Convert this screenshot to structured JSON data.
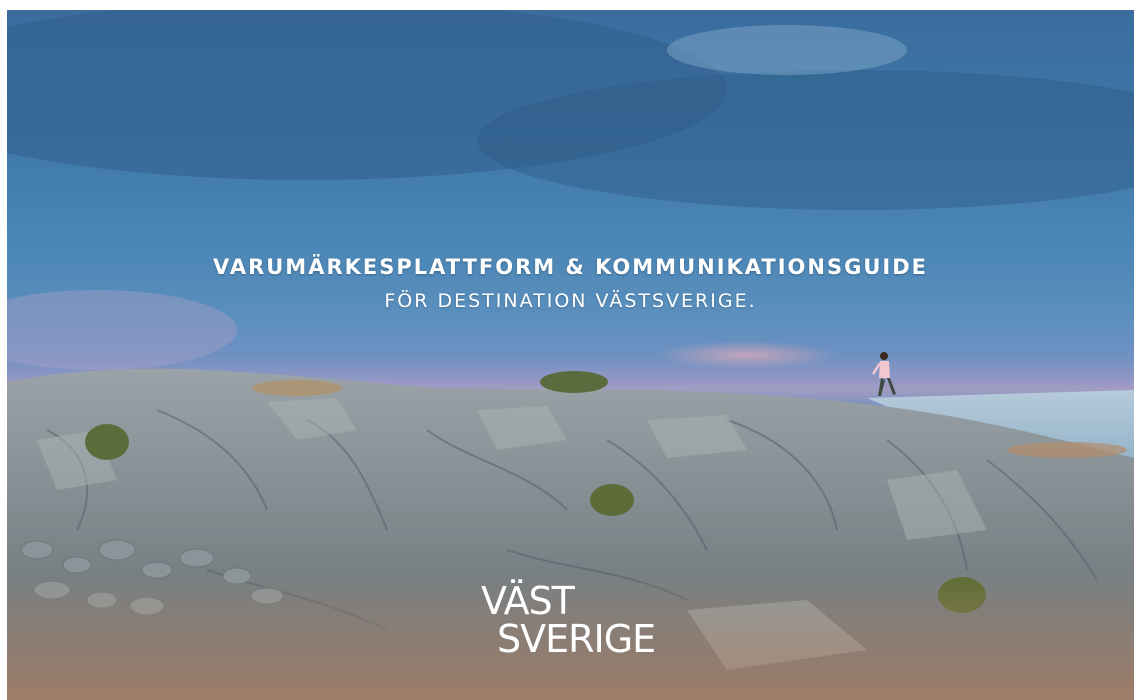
{
  "cover": {
    "headline": "VARUMÄRKESPLATTFORM & KOMMUNIKATIONSGUIDE",
    "subline": "FÖR DESTINATION VÄSTSVERIGE.",
    "logo": {
      "line1": "VÄST",
      "line2": "SVERIGE"
    }
  },
  "image": {
    "subject": "person-walking-icon",
    "colors": {
      "sky": "#4a86b6",
      "horizon_glow": "#a39cc3",
      "rock": "#8c969b",
      "water": "#a9c2d6",
      "text": "#ffffff"
    }
  }
}
